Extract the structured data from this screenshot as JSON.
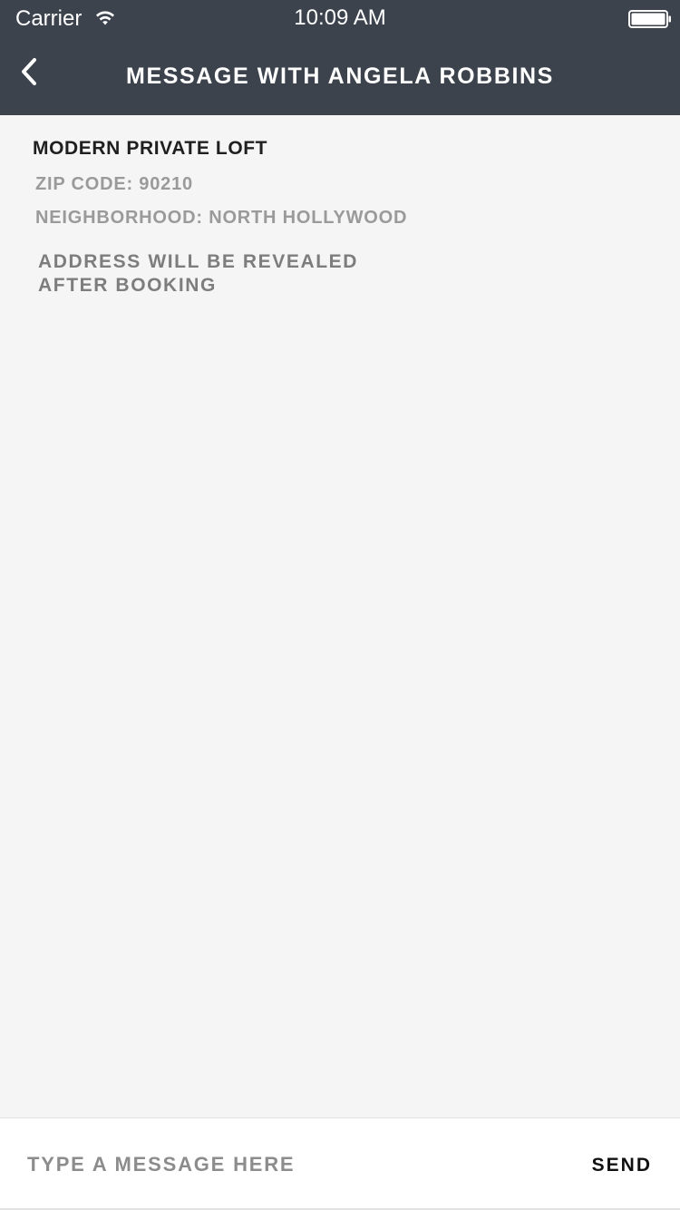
{
  "status_bar": {
    "carrier": "Carrier",
    "time": "10:09 AM",
    "wifi_icon": "wifi-icon",
    "battery_icon": "battery-icon"
  },
  "nav": {
    "title": "MESSAGE WITH ANGELA ROBBINS",
    "back_icon": "chevron-left-icon"
  },
  "listing": {
    "title": "MODERN PRIVATE LOFT",
    "zip": "ZIP CODE: 90210",
    "neighborhood": "NEIGHBORHOOD: NORTH HOLLYWOOD",
    "address_note_line1": "ADDRESS WILL BE REVEALED",
    "address_note_line2": "AFTER BOOKING"
  },
  "composer": {
    "placeholder": "TYPE A MESSAGE HERE",
    "value": "",
    "send_label": "SEND"
  },
  "colors": {
    "header_bg": "#3c434d",
    "content_bg": "#f5f5f5",
    "composer_bg": "#ffffff"
  }
}
